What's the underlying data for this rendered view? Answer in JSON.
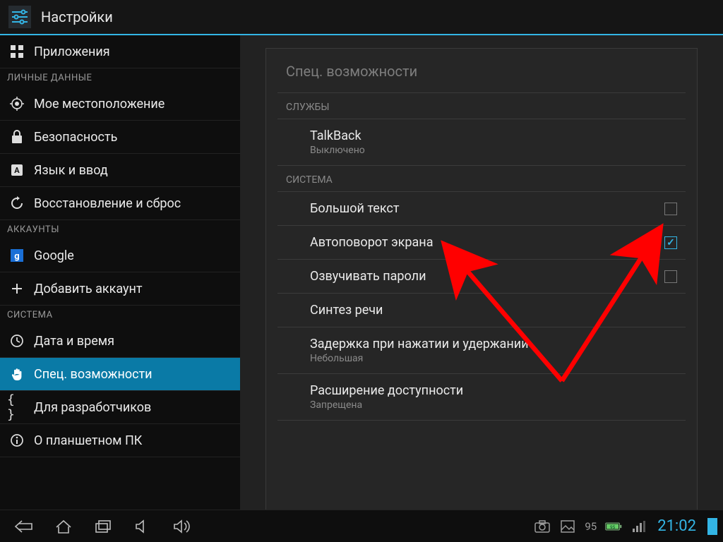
{
  "titlebar": {
    "title": "Настройки"
  },
  "sidebar": {
    "top_item": {
      "label": "Приложения"
    },
    "cat_personal": "ЛИЧНЫЕ ДАННЫЕ",
    "personal": [
      {
        "label": "Мое местоположение"
      },
      {
        "label": "Безопасность"
      },
      {
        "label": "Язык и ввод"
      },
      {
        "label": "Восстановление и сброс"
      }
    ],
    "cat_accounts": "АККАУНТЫ",
    "accounts": [
      {
        "label": "Google"
      },
      {
        "label": "Добавить аккаунт"
      }
    ],
    "cat_system": "СИСТЕМА",
    "system": [
      {
        "label": "Дата и время"
      },
      {
        "label": "Спец. возможности",
        "selected": true
      },
      {
        "label": "Для разработчиков"
      },
      {
        "label": "О планшетном ПК"
      }
    ]
  },
  "panel": {
    "title": "Спец. возможности",
    "cat_services": "СЛУЖБЫ",
    "talkback": {
      "title": "TalkBack",
      "status": "Выключено"
    },
    "cat_system": "СИСТЕМА",
    "rows": {
      "large_text": {
        "label": "Большой текст",
        "checked": false
      },
      "auto_rotate": {
        "label": "Автоповорот экрана",
        "checked": true
      },
      "speak_passwords": {
        "label": "Озвучивать пароли",
        "checked": false
      },
      "tts": {
        "label": "Синтез речи"
      },
      "touch_hold": {
        "label": "Задержка при нажатии и удержании",
        "sub": "Небольшая"
      },
      "access_ext": {
        "label": "Расширение доступности",
        "sub": "Запрещена"
      }
    }
  },
  "statusbar": {
    "battery_pct": "95",
    "battery_badge": "95",
    "clock": "21:02"
  }
}
